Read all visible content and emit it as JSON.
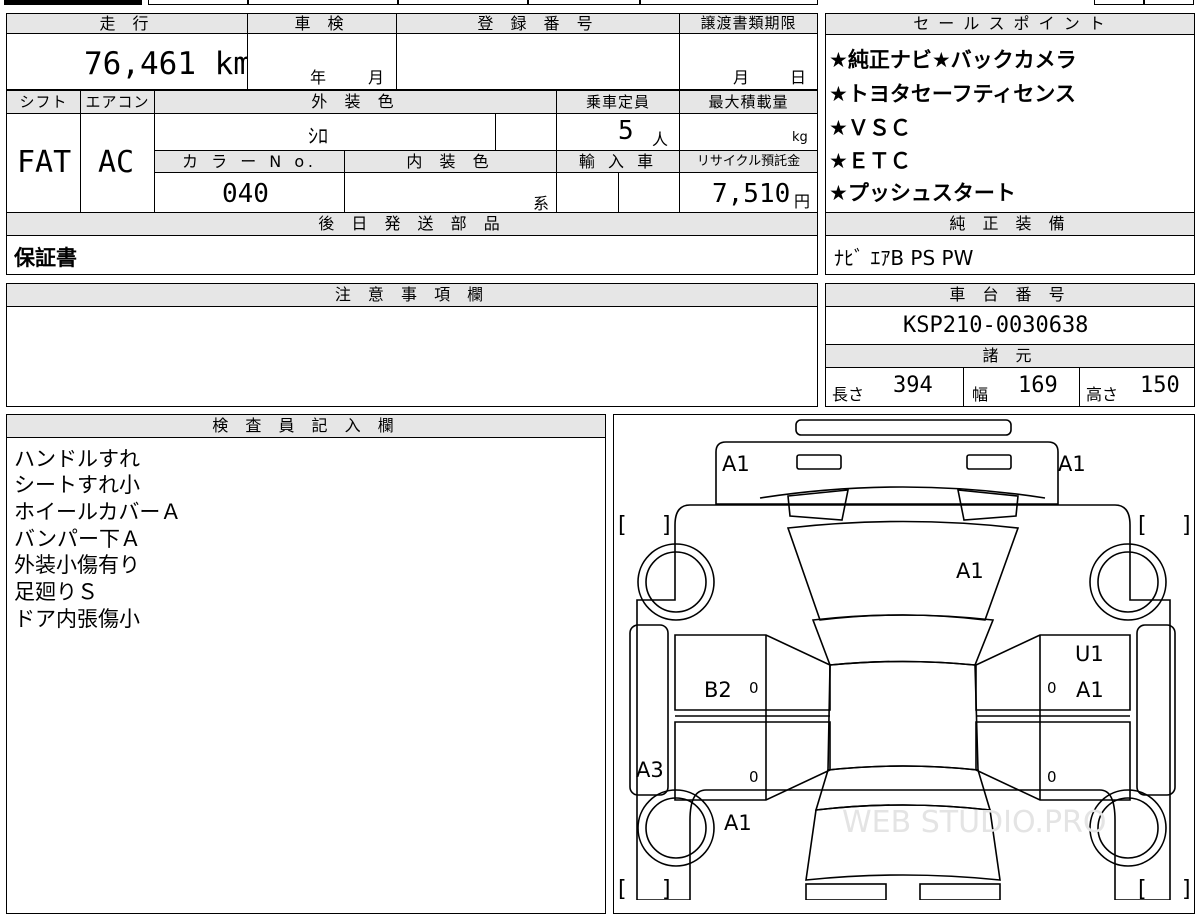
{
  "headers": {
    "mileage": "走 行",
    "inspection": "車 検",
    "registration_number": "登 録 番 号",
    "transfer_deadline": "譲渡書類期限",
    "shift": "シフト",
    "aircon": "エアコン",
    "exterior_color": "外 装 色",
    "capacity": "乗車定員",
    "max_load": "最大積載量",
    "color_no": "カ ラ ー N o.",
    "interior_color": "内 装 色",
    "import": "輸 入 車",
    "recycle_fee": "リサイクル預託金",
    "later_parts": "後 日 発 送 部 品",
    "sales_points": "セ ー ル ス ポ イ ン ト",
    "standard_equipment": "純 正 装 備",
    "notes": "注 意 事 項 欄",
    "chassis_number": "車 台 番 号",
    "specs": "諸 元",
    "inspector_notes": "検 査 員 記 入 欄"
  },
  "vehicle": {
    "mileage": "76,461 km",
    "inspection_year_unit": "年",
    "inspection_month_unit": "月",
    "transfer_month_unit": "月",
    "transfer_day_unit": "日",
    "shift": "FAT",
    "aircon": "AC",
    "exterior_color": "ｼﾛ",
    "capacity": "5",
    "capacity_unit": "人",
    "max_load_unit": "kg",
    "color_no": "040",
    "interior_color_suffix": "系",
    "recycle_fee": "7,510",
    "recycle_fee_unit": "円",
    "later_parts": "保証書",
    "chassis_number": "KSP210-0030638",
    "standard_equipment": "ﾅﾋﾞ ｴｱB PS PW"
  },
  "specs": {
    "length_label": "長さ",
    "length": "394",
    "width_label": "幅",
    "width": "169",
    "height_label": "高さ",
    "height": "150"
  },
  "sales_points": [
    "★純正ナビ★バックカメラ",
    "★トヨタセーフティセンス",
    "★ＶＳＣ",
    "★ＥＴＣ",
    "★プッシュスタート"
  ],
  "inspector_notes": [
    "ハンドルすれ",
    "シートすれ小",
    "ホイールカバーＡ",
    "バンパー下Ａ",
    "外装小傷有り",
    "足廻りＳ",
    "ドア内張傷小"
  ],
  "diagram_marks": {
    "front_left": "A1",
    "front_right": "A1",
    "hood": "A1",
    "left_front_door": "B2",
    "right_front_door_upper": "U1",
    "right_front_door": "A1",
    "left_rocker": "A3",
    "left_rear_fender": "A1",
    "door_code": "0",
    "bracket_open": "[",
    "bracket_close": "]"
  },
  "watermark": "WEB STUDIO.PRO"
}
